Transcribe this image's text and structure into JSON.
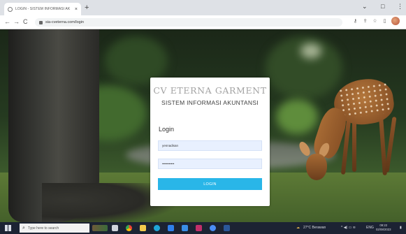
{
  "browser": {
    "tab_title": "LOGIN - SISTEM INFORMASI AK",
    "tab_close": "×",
    "new_tab": "+",
    "url": "sia-cveterna.com/login",
    "nav_back": "←",
    "nav_forward": "→",
    "nav_reload": "C",
    "minimize": "⌄",
    "more": "⋮",
    "close_window": "×"
  },
  "login_card": {
    "brand": "CV ETERNA GARMENT",
    "subtitle": "SISTEM INFORMASI AKUNTANSI",
    "heading": "Login",
    "username_value": "yennadisan",
    "password_value": "•••••••••••",
    "button_label": "LOGIN"
  },
  "taskbar": {
    "search_placeholder": "Type here to search",
    "weather": "27°C Berawan",
    "language": "ENG",
    "time": "09:22",
    "date": "02/08/2023"
  },
  "colors": {
    "button": "#29b6e8",
    "input_bg": "#e8f0fe",
    "taskbar": "#1c2333"
  }
}
